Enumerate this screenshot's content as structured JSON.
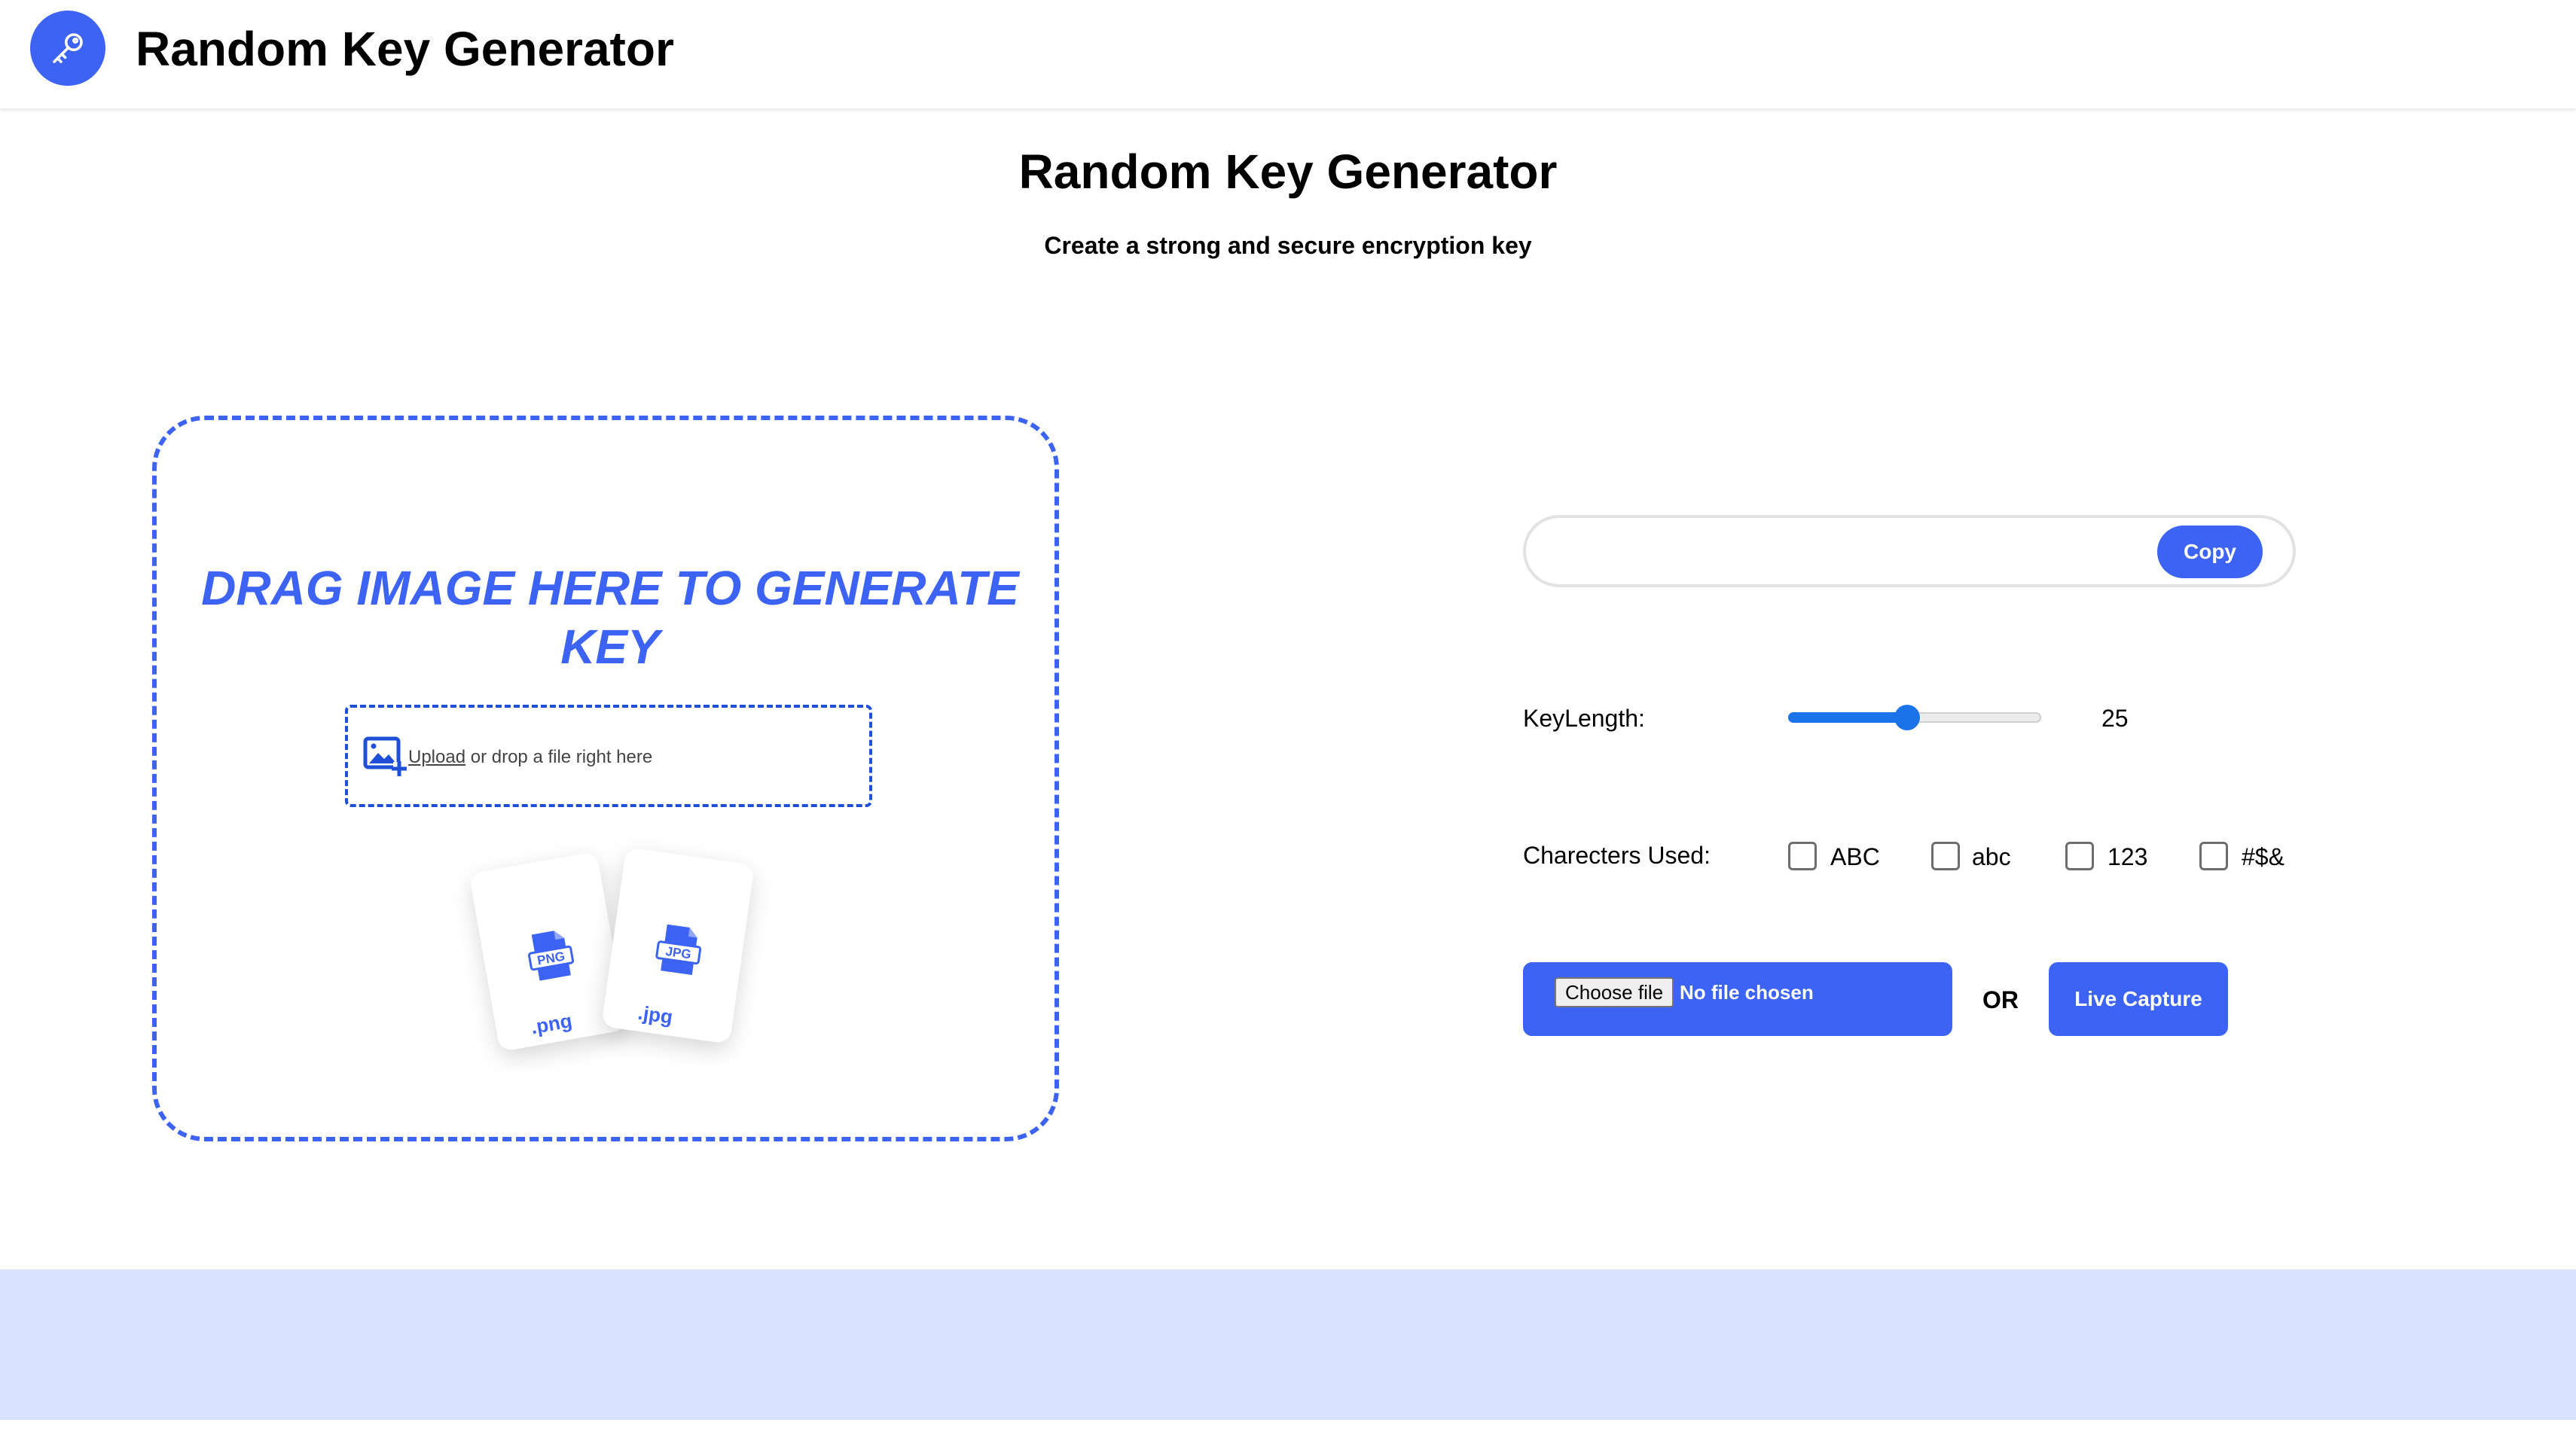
{
  "header": {
    "app_title": "Random Key Generator",
    "logo_icon": "key-icon"
  },
  "hero": {
    "title": "Random Key Generator",
    "subtitle": "Create a strong and secure encryption key"
  },
  "dropzone": {
    "heading": "DRAG IMAGE HERE TO GENERATE KEY",
    "upload_link": "Upload",
    "upload_rest": " or drop a file right here",
    "upload_icon": "image-add-icon",
    "cards": [
      {
        "icon": "png-file-icon",
        "label": ".png"
      },
      {
        "icon": "jpg-file-icon",
        "label": ".jpg"
      }
    ]
  },
  "key_output": {
    "value": "",
    "copy_label": "Copy"
  },
  "key_length": {
    "label": "KeyLength:",
    "value": "25",
    "slider_fraction": 0.47
  },
  "characters": {
    "label": "Charecters Used:",
    "options": [
      {
        "label": "ABC",
        "checked": false
      },
      {
        "label": "abc",
        "checked": false
      },
      {
        "label": "123",
        "checked": false
      },
      {
        "label": "#$&",
        "checked": false
      }
    ]
  },
  "file_input": {
    "button_label": "Choose file",
    "status": "No file chosen"
  },
  "or_label": "OR",
  "live_capture_label": "Live Capture",
  "colors": {
    "accent": "#3d63f5",
    "slider": "#1a73e8",
    "footer": "#d9e2fe"
  }
}
